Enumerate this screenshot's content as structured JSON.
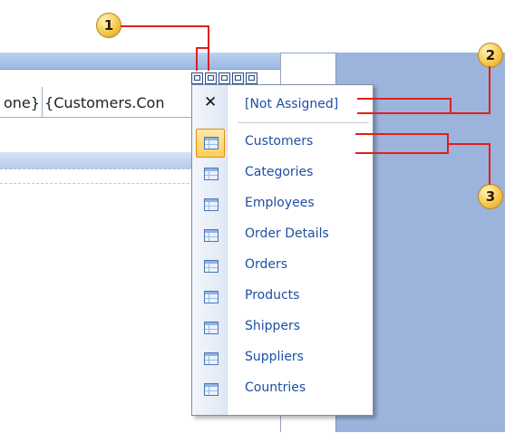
{
  "designer": {
    "row_text": "one} {Customers.Con"
  },
  "smart_tag": {
    "buttons": [
      "tasks-icon",
      "layout-icon",
      "zoom-icon",
      "expand-icon",
      "restore-icon"
    ]
  },
  "popup": {
    "close_glyph": "✕",
    "not_assigned": "[Not Assigned]",
    "items": [
      {
        "label": "Customers",
        "selected": true
      },
      {
        "label": "Categories"
      },
      {
        "label": "Employees"
      },
      {
        "label": "Order Details"
      },
      {
        "label": "Orders"
      },
      {
        "label": "Products"
      },
      {
        "label": "Shippers"
      },
      {
        "label": "Suppliers"
      },
      {
        "label": "Countries"
      }
    ]
  },
  "callouts": {
    "one": "1",
    "two": "2",
    "three": "3"
  },
  "colors": {
    "callout_line": "#e0201c",
    "link_text": "#1d4fa3",
    "selection": "#ffcd5e",
    "right_strip": "#9cb4dc"
  }
}
